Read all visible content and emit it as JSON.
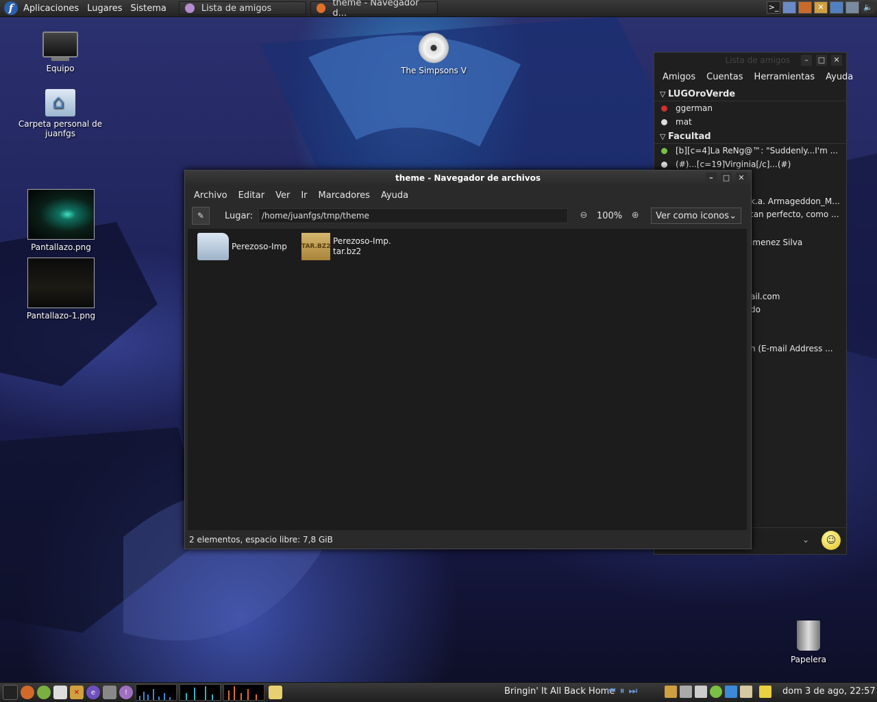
{
  "top_panel": {
    "menus": [
      "Aplicaciones",
      "Lugares",
      "Sistema"
    ],
    "tasks": [
      {
        "label": "Lista de amigos",
        "icon": "pidgin-icon"
      },
      {
        "label": "theme - Navegador d...",
        "icon": "firefox-icon"
      }
    ]
  },
  "desktop": {
    "icons": {
      "equipo": "Equipo",
      "home": "Carpeta personal de juanfgs",
      "cd": "The Simpsons V",
      "shot1": "Pantallazo.png",
      "shot2": "Pantallazo-1.png",
      "trash": "Papelera"
    }
  },
  "buddy_list": {
    "title": "Lista de amigos",
    "menu": [
      "Amigos",
      "Cuentas",
      "Herramientas",
      "Ayuda"
    ],
    "groups": [
      {
        "name": "LUGOroVerde",
        "buddies": [
          {
            "name": "ggerman",
            "status": "busy"
          },
          {
            "name": "mat",
            "status": "away"
          }
        ]
      },
      {
        "name": "Facultad",
        "buddies": [
          {
            "name": "[b][c=4]La ReNg@™: \"Suddenly...I'm ...",
            "status": "available"
          },
          {
            "name": "(#)...[c=19]Virginia[/c]...(#)",
            "status": "away"
          }
        ]
      }
    ],
    "partial_rows": [
      "k.a. Armageddon_M...",
      "tan perfecto, como ...",
      "imenez Silva",
      "ail.com",
      "do",
      "n (E-mail Address ..."
    ]
  },
  "file_manager": {
    "title": "theme - Navegador de archivos",
    "menu": [
      "Archivo",
      "Editar",
      "Ver",
      "Ir",
      "Marcadores",
      "Ayuda"
    ],
    "location_label": "Lugar:",
    "location_value": "/home/juanfgs/tmp/theme",
    "zoom": "100%",
    "view_mode": "Ver como iconos",
    "items": [
      {
        "name": "Perezoso-Imp",
        "type": "folder"
      },
      {
        "name": "Perezoso-Imp.\ntar.bz2",
        "type": "archive",
        "badge": "TAR.BZ2"
      }
    ],
    "status": "2 elementos, espacio libre: 7,8 GiB"
  },
  "bottom_panel": {
    "now_playing": "Bringin' It All Back Home",
    "clock": "dom  3 de ago, 22:57"
  }
}
